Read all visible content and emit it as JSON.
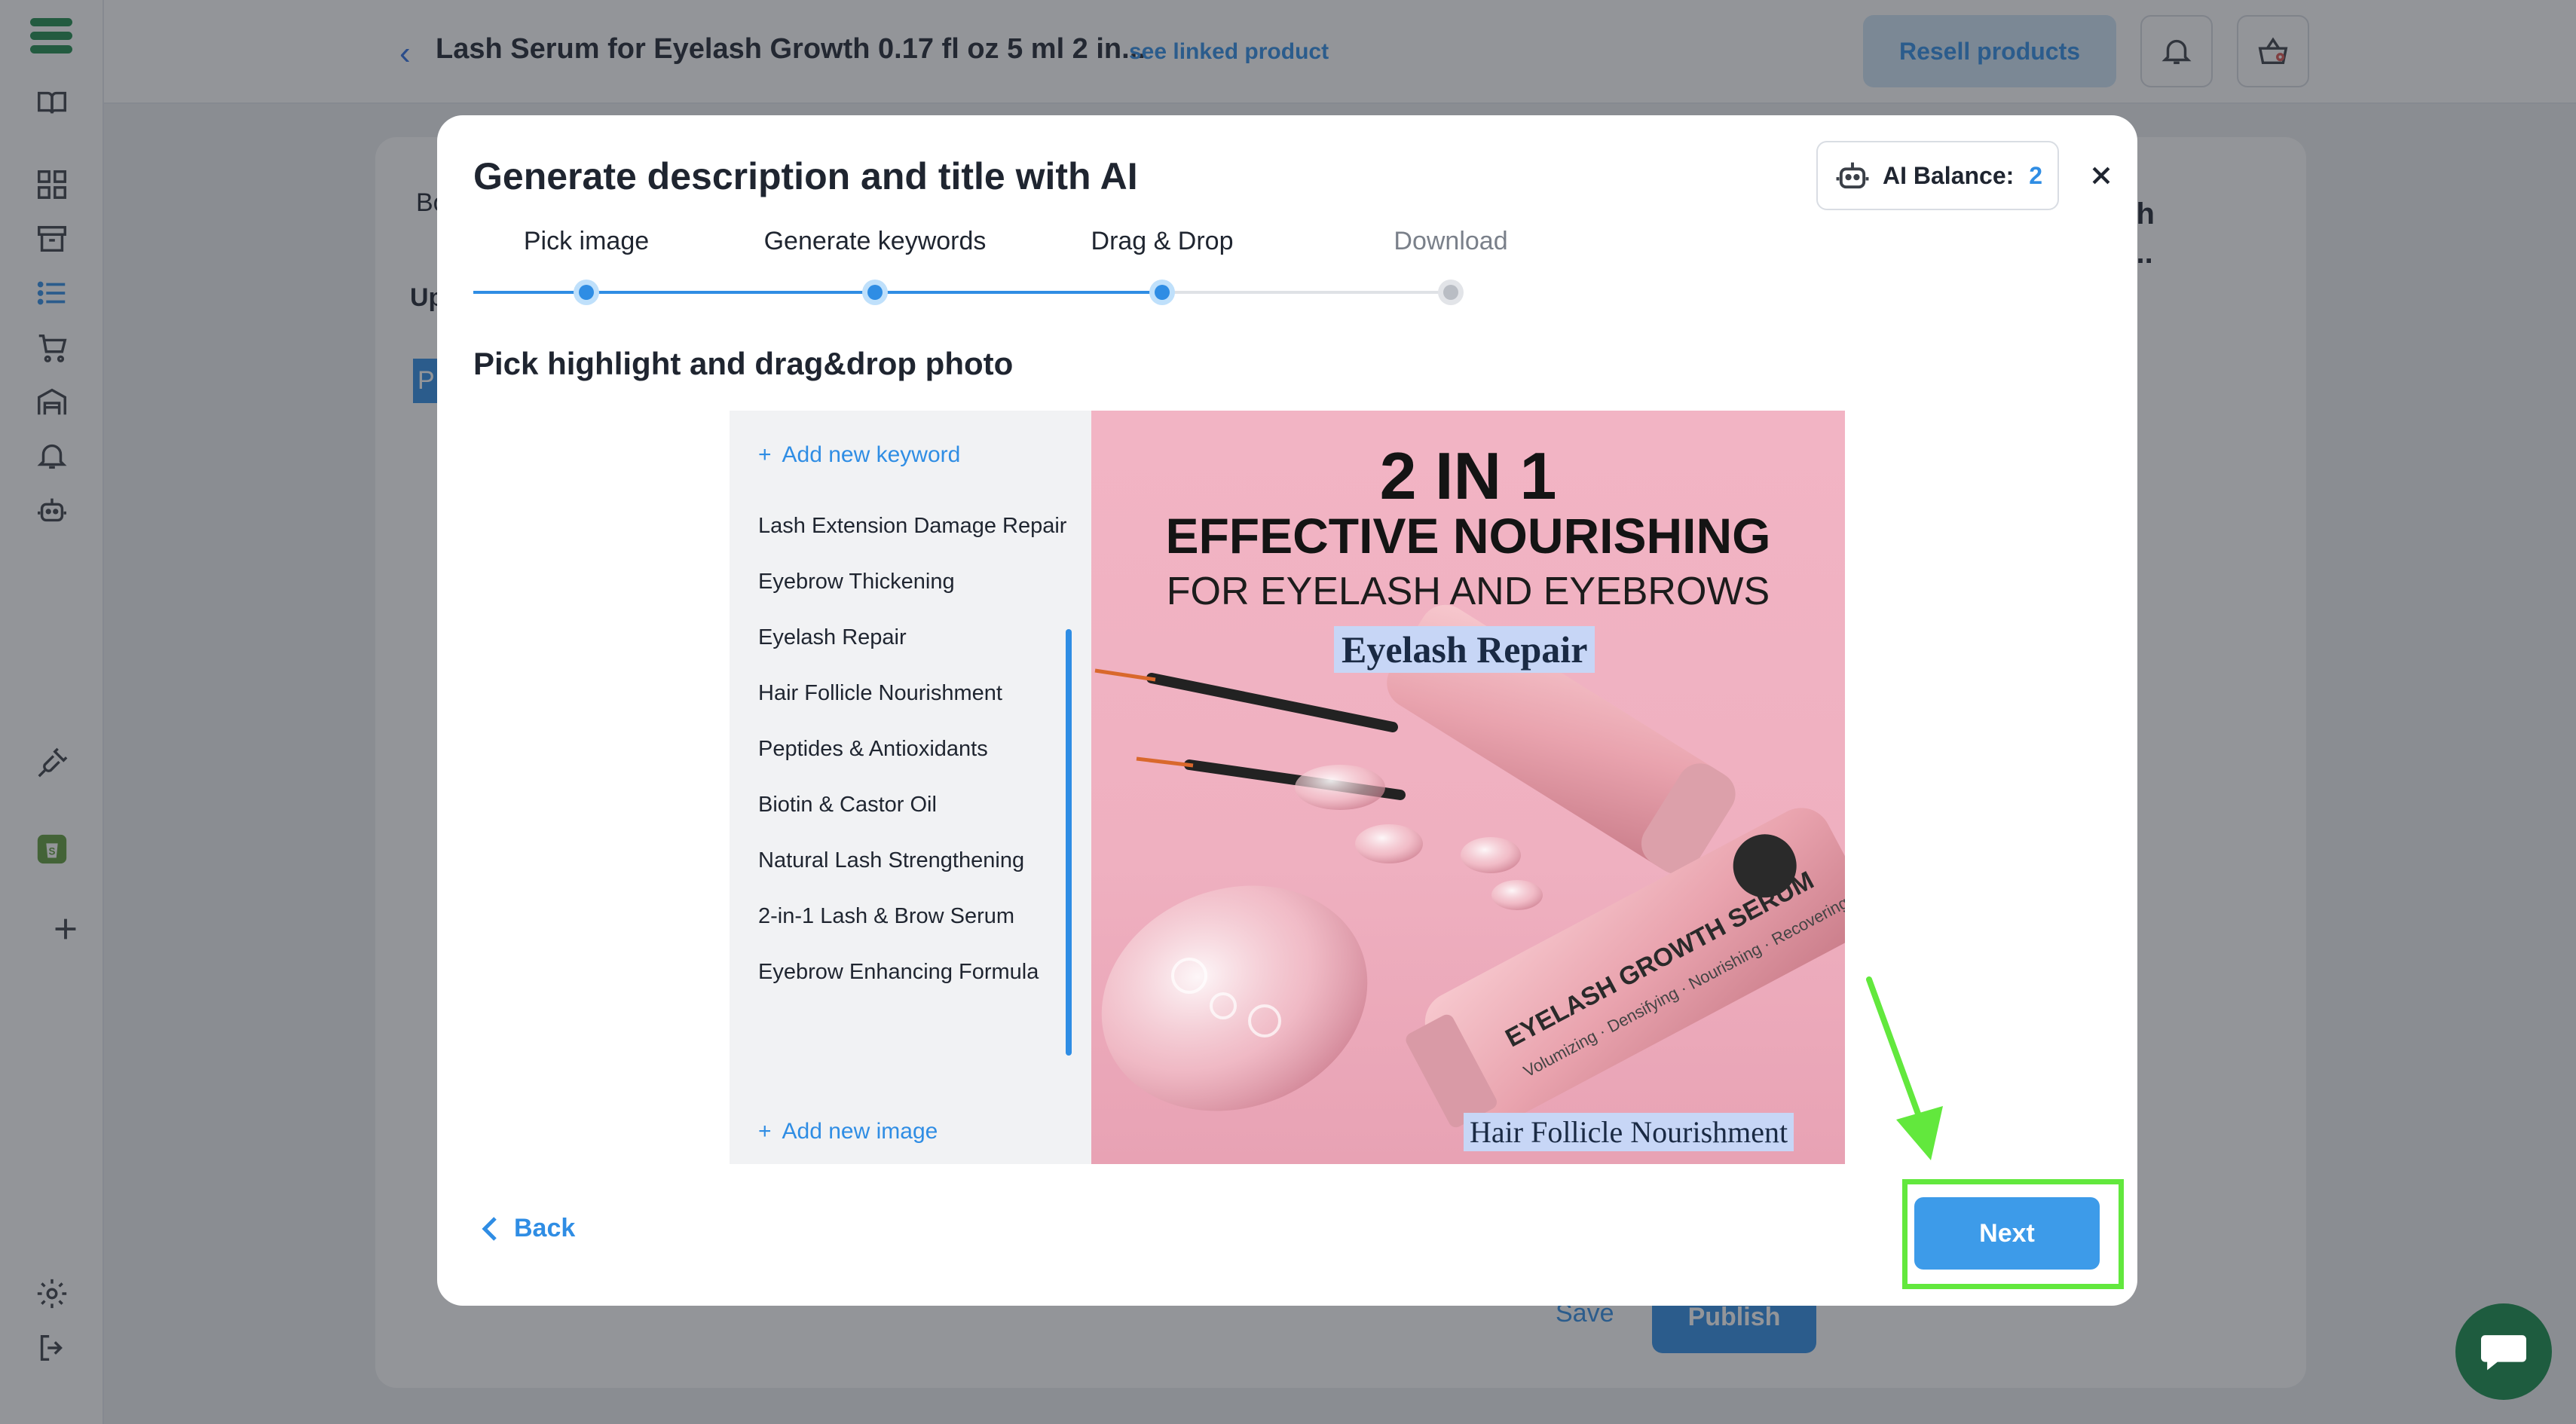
{
  "topbar": {
    "product_title": "Lash Serum for Eyelash Growth 0.17 fl oz 5 ml 2 in...",
    "linked_product": "see linked product",
    "resell_button": "Resell products"
  },
  "background": {
    "left_fragment_1": "Bo",
    "left_fragment_2": "Up",
    "left_fragment_3": "P",
    "right_title_line1": "ash",
    "right_title_line2": "al...",
    "save": "Save",
    "publish": "Publish"
  },
  "modal": {
    "title": "Generate description and title with AI",
    "ai_balance_label": "AI Balance:",
    "ai_balance_value": "2",
    "steps": [
      {
        "label": "Pick image",
        "state": "done"
      },
      {
        "label": "Generate keywords",
        "state": "done"
      },
      {
        "label": "Drag & Drop",
        "state": "done"
      },
      {
        "label": "Download",
        "state": "todo"
      }
    ],
    "section_heading": "Pick highlight and drag&drop photo",
    "add_keyword": "Add new keyword",
    "keywords": [
      "Lash Extension Damage Repair",
      "Eyebrow Thickening",
      "Eyelash Repair",
      "Hair Follicle Nourishment",
      "Peptides & Antioxidants",
      "Biotin & Castor Oil",
      "Natural Lash Strengthening",
      "2-in-1 Lash & Brow Serum",
      "Eyebrow Enhancing Formula"
    ],
    "add_image": "Add new image",
    "image": {
      "line1": "2 IN 1",
      "line2": "EFFECTIVE NOURISHING",
      "line3": "FOR EYELASH AND EYEBROWS",
      "highlight_top": "Eyelash Repair",
      "highlight_bottom": "Hair Follicle Nourishment",
      "bottle_label": "EYELASH GROWTH SERUM",
      "bottle_side": "Volumizing · Densifying · Nourishing · Recovering"
    },
    "back": "Back",
    "next": "Next"
  },
  "colors": {
    "accent": "#2f8de4",
    "annotation": "#62e83d",
    "brand": "#1f8a4c"
  }
}
